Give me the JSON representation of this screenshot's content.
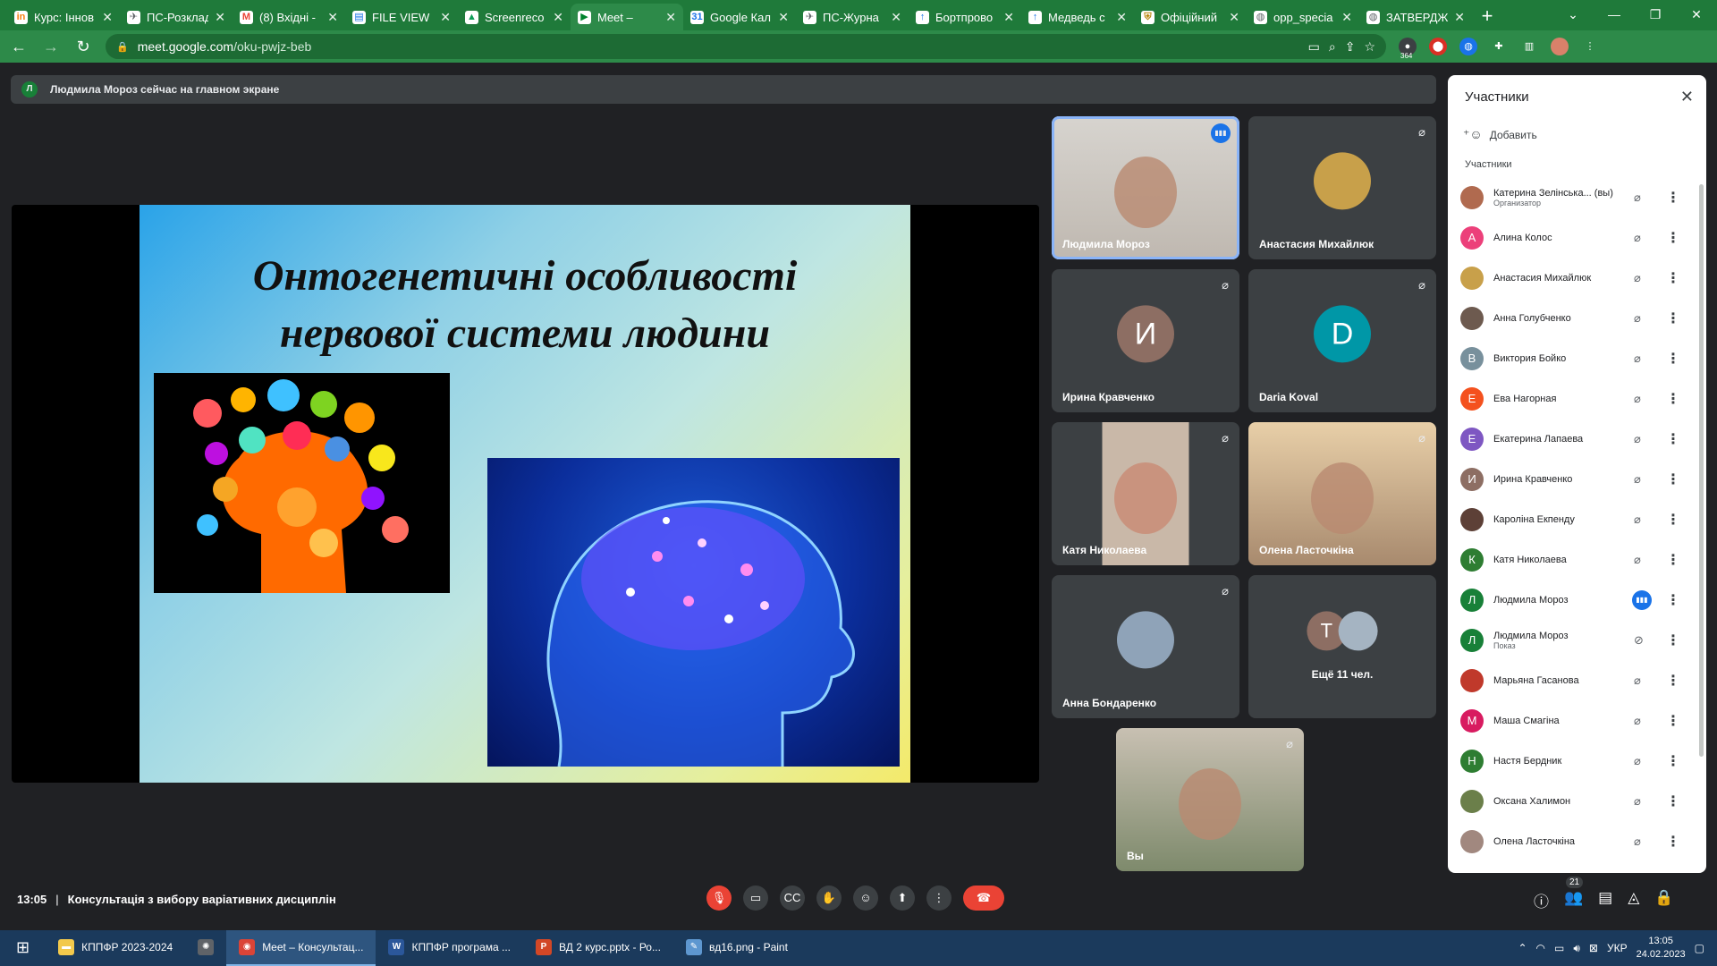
{
  "browser": {
    "tabs": [
      {
        "label": "Курс: Іннов",
        "icon": "moodle-icon",
        "color": "#f98012",
        "glyph": "in"
      },
      {
        "label": "ПС-Розклад",
        "icon": "rocket-icon",
        "color": "#5f6368",
        "glyph": "✈"
      },
      {
        "label": "(8) Вхідні -",
        "icon": "gmail-icon",
        "color": "#ea4335",
        "glyph": "M"
      },
      {
        "label": "FILE VIEW",
        "icon": "doc-icon",
        "color": "#1a73e8",
        "glyph": "▤"
      },
      {
        "label": "Screenreco",
        "icon": "drive-icon",
        "color": "#0f9d58",
        "glyph": "▲"
      },
      {
        "label": "Meet –",
        "icon": "meet-icon",
        "color": "#00832d",
        "glyph": "▶"
      },
      {
        "label": "Google Кал",
        "icon": "calendar-icon",
        "color": "#1a73e8",
        "glyph": "31"
      },
      {
        "label": "ПС-Журна",
        "icon": "rocket-icon",
        "color": "#5f6368",
        "glyph": "✈"
      },
      {
        "label": "Бортпрово",
        "icon": "arrow-up-icon",
        "color": "#1a73e8",
        "glyph": "↑"
      },
      {
        "label": "Медведь с",
        "icon": "arrow-up-icon",
        "color": "#1a73e8",
        "glyph": "↑"
      },
      {
        "label": "Офіційний",
        "icon": "shield-icon",
        "color": "#b8860b",
        "glyph": "⛨"
      },
      {
        "label": "opp_specia",
        "icon": "globe-icon",
        "color": "#5f6368",
        "glyph": "◍"
      },
      {
        "label": "ЗАТВЕРДЖ",
        "icon": "globe-icon",
        "color": "#5f6368",
        "glyph": "◍"
      }
    ],
    "active_tab": 5,
    "url_host": "meet.google.com",
    "url_path": "/oku-pwjz-beb",
    "ext_badge": "364"
  },
  "banner": {
    "avatar_letter": "Л",
    "text": "Людмила Мороз сейчас на главном экране"
  },
  "slide": {
    "title_line1": "Онтогенетичні особливості",
    "title_line2": "нервової системи людини"
  },
  "tiles": [
    {
      "name": "Людмила Мороз",
      "type": "video",
      "speaking": true,
      "mic": "speaking-icon"
    },
    {
      "name": "Анастасия Михайлюк",
      "type": "photo",
      "photo_color": "#c8a04a",
      "mic": "mic-off-icon"
    },
    {
      "name": "Ирина Кравченко",
      "type": "letter",
      "letter": "И",
      "color": "#8d6e63",
      "mic": "mic-off-icon"
    },
    {
      "name": "Daria Koval",
      "type": "letter",
      "letter": "D",
      "color": "#0097a7",
      "mic": "mic-off-icon"
    },
    {
      "name": "Катя Николаева",
      "type": "video",
      "mic": "mic-off-icon"
    },
    {
      "name": "Олена Ласточкіна",
      "type": "video",
      "mic": "mic-off-icon"
    },
    {
      "name": "Анна Бондаренко",
      "type": "photo",
      "photo_color": "#8fa3b8",
      "mic": "mic-off-icon"
    },
    {
      "name": "Ещё 11 чел.",
      "type": "more",
      "letter": "Т",
      "color": "#8d6e63"
    },
    {
      "name": "Вы",
      "type": "video",
      "mic": "mic-off-icon"
    }
  ],
  "panel": {
    "title": "Участники",
    "add_label": "Добавить",
    "section": "Участники",
    "participants": [
      {
        "name": "Катерина Зелінська... (вы)",
        "sub": "Организатор",
        "letter": "",
        "color": "#b06a4f",
        "mic": "mic-off-icon"
      },
      {
        "name": "Алина Колос",
        "sub": "",
        "letter": "А",
        "color": "#ec407a",
        "mic": "mic-off-icon"
      },
      {
        "name": "Анастасия Михайлюк",
        "sub": "",
        "letter": "",
        "color": "#c8a04a",
        "mic": "mic-off-icon"
      },
      {
        "name": "Анна Голубченко",
        "sub": "",
        "letter": "",
        "color": "#6d5a4f",
        "mic": "mic-off-icon"
      },
      {
        "name": "Виктория Бойко",
        "sub": "",
        "letter": "В",
        "color": "#78909c",
        "mic": "mic-off-icon"
      },
      {
        "name": "Ева Нагорная",
        "sub": "",
        "letter": "Е",
        "color": "#f4511e",
        "mic": "mic-off-icon"
      },
      {
        "name": "Екатерина Лапаева",
        "sub": "",
        "letter": "Е",
        "color": "#7e57c2",
        "mic": "mic-off-icon"
      },
      {
        "name": "Ирина Кравченко",
        "sub": "",
        "letter": "И",
        "color": "#8d6e63",
        "mic": "mic-off-icon"
      },
      {
        "name": "Кароліна Екпенду",
        "sub": "",
        "letter": "",
        "color": "#5d4037",
        "mic": "mic-off-icon"
      },
      {
        "name": "Катя Николаева",
        "sub": "",
        "letter": "К",
        "color": "#2e7d32",
        "mic": "mic-off-icon"
      },
      {
        "name": "Людмила Мороз",
        "sub": "",
        "letter": "Л",
        "color": "#188038",
        "mic": "speaking-icon"
      },
      {
        "name": "Людмила Мороз",
        "sub": "Показ",
        "letter": "Л",
        "color": "#188038",
        "mic": "present-off-icon"
      },
      {
        "name": "Марьяна Гасанова",
        "sub": "",
        "letter": "",
        "color": "#c0392b",
        "mic": "mic-off-icon"
      },
      {
        "name": "Маша Смагіна",
        "sub": "",
        "letter": "М",
        "color": "#d81b60",
        "mic": "mic-off-icon"
      },
      {
        "name": "Настя Бердник",
        "sub": "",
        "letter": "Н",
        "color": "#2e7d32",
        "mic": "mic-off-icon"
      },
      {
        "name": "Оксана Халимон",
        "sub": "",
        "letter": "",
        "color": "#6b7f4a",
        "mic": "mic-off-icon"
      },
      {
        "name": "Олена Ласточкіна",
        "sub": "",
        "letter": "",
        "color": "#a1887f",
        "mic": "mic-off-icon"
      }
    ]
  },
  "meeting": {
    "time": "13:05",
    "title": "Консультація з вибору варіативних дисциплін",
    "people_count": "21"
  },
  "taskbar": {
    "items": [
      {
        "label": "КППФР 2023-2024",
        "icon": "folder-icon",
        "color": "#f2c94c",
        "glyph": "▬"
      },
      {
        "label": "",
        "icon": "sparkle-icon",
        "color": "#5f6368",
        "glyph": "✺"
      },
      {
        "label": "Meet – Консультац...",
        "icon": "chrome-icon",
        "color": "#db4437",
        "glyph": "◉",
        "active": true
      },
      {
        "label": "КППФР програма ...",
        "icon": "word-icon",
        "color": "#2b579a",
        "glyph": "W"
      },
      {
        "label": "ВД 2 курс.pptx - Ро...",
        "icon": "powerpoint-icon",
        "color": "#d24726",
        "glyph": "P"
      },
      {
        "label": "вд16.png - Paint",
        "icon": "paint-icon",
        "color": "#5e97d0",
        "glyph": "✎"
      }
    ],
    "lang": "УКР",
    "time": "13:05",
    "date": "24.02.2023"
  }
}
